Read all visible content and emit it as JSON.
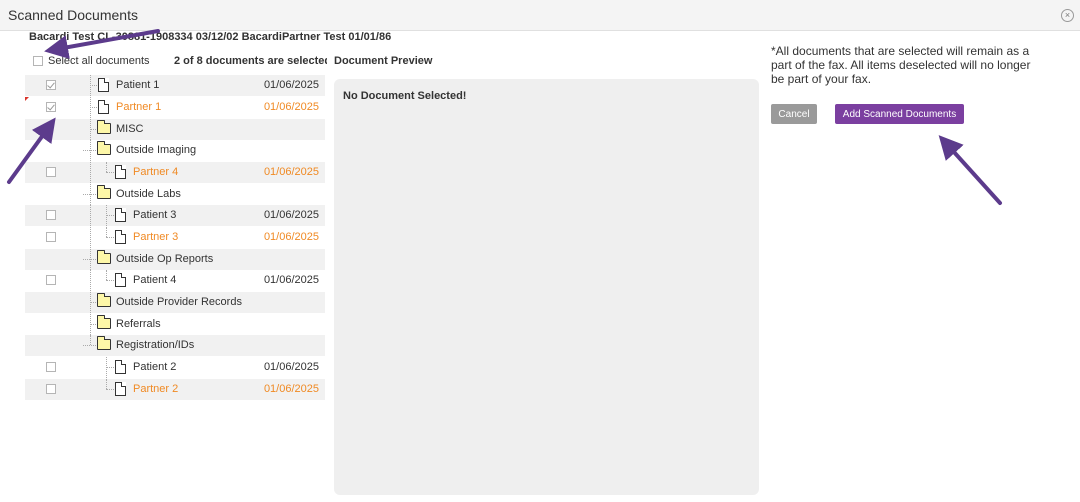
{
  "window": {
    "title": "Scanned Documents"
  },
  "patient_info": "Bacardi Test CL-30881-1908334 03/12/02 BacardiPartner Test 01/01/86",
  "select_all_label": "Select all documents",
  "selected_count": "2 of 8 documents are selected",
  "preview": {
    "label": "Document Preview",
    "empty_text": "No Document Selected!"
  },
  "note": "*All documents that are selected will remain as a part of the fax. All items deselected will no longer be part of your fax.",
  "buttons": {
    "cancel": "Cancel",
    "add": "Add Scanned Documents"
  },
  "colors": {
    "accent": "#7b3fa0",
    "orange": "#f08a24",
    "cancel_gray": "#9a9a9a"
  },
  "tree": [
    {
      "type": "doc",
      "label": "Patient 1",
      "date": "01/06/2025",
      "checked": true,
      "orange": false
    },
    {
      "type": "doc",
      "label": "Partner 1",
      "date": "01/06/2025",
      "checked": true,
      "orange": true
    },
    {
      "type": "folder",
      "label": "MISC"
    },
    {
      "type": "folder",
      "label": "Outside Imaging"
    },
    {
      "type": "doc",
      "label": "Partner 4",
      "date": "01/06/2025",
      "checked": false,
      "orange": true
    },
    {
      "type": "folder",
      "label": "Outside Labs"
    },
    {
      "type": "doc",
      "label": "Patient 3",
      "date": "01/06/2025",
      "checked": false,
      "orange": false
    },
    {
      "type": "doc",
      "label": "Partner 3",
      "date": "01/06/2025",
      "checked": false,
      "orange": true
    },
    {
      "type": "folder",
      "label": "Outside Op Reports"
    },
    {
      "type": "doc",
      "label": "Patient 4",
      "date": "01/06/2025",
      "checked": false,
      "orange": false
    },
    {
      "type": "folder",
      "label": "Outside Provider Records"
    },
    {
      "type": "folder",
      "label": "Referrals"
    },
    {
      "type": "folder",
      "label": "Registration/IDs"
    },
    {
      "type": "doc",
      "label": "Patient 2",
      "date": "01/06/2025",
      "checked": false,
      "orange": false
    },
    {
      "type": "doc",
      "label": "Partner 2",
      "date": "01/06/2025",
      "checked": false,
      "orange": true
    }
  ]
}
